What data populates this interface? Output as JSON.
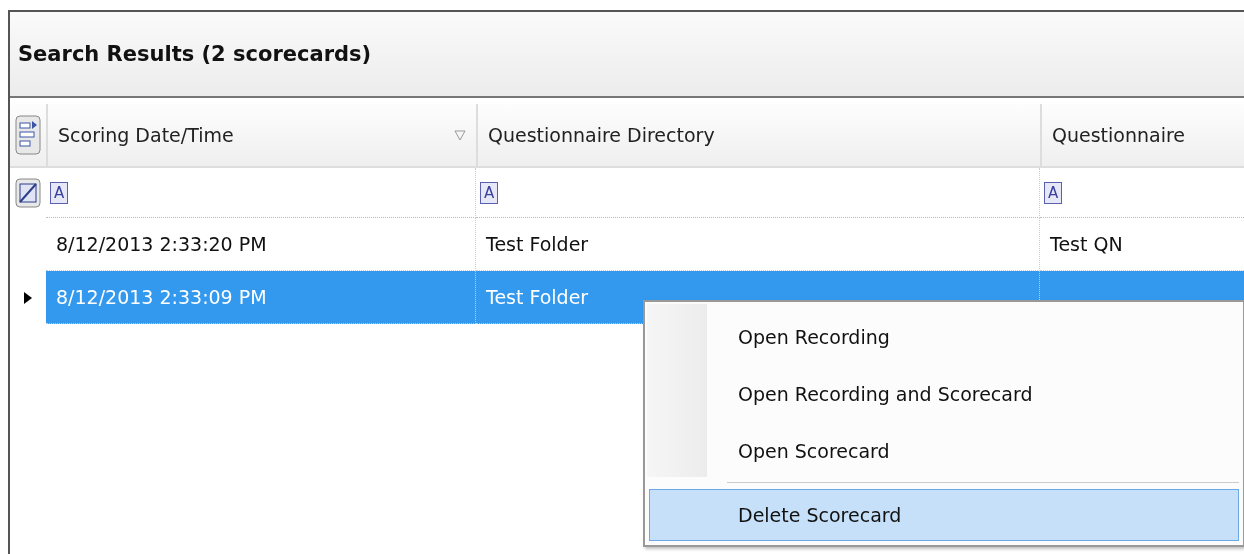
{
  "panel": {
    "title": "Search Results (2 scorecards)"
  },
  "table": {
    "columns": [
      {
        "label": "Scoring Date/Time",
        "sorted": true,
        "filter_glyph": "A"
      },
      {
        "label": "Questionnaire Directory",
        "filter_glyph": "A"
      },
      {
        "label": "Questionnaire",
        "filter_glyph": "A"
      }
    ],
    "rows": [
      {
        "selected": false,
        "cells": [
          "8/12/2013 2:33:20 PM",
          "Test Folder",
          "Test QN"
        ]
      },
      {
        "selected": true,
        "cells": [
          "8/12/2013 2:33:09 PM",
          "Test Folder"
        ]
      }
    ]
  },
  "context_menu": {
    "items": [
      {
        "kind": "item",
        "label": "Open Recording",
        "selected": false
      },
      {
        "kind": "item",
        "label": "Open Recording and Scorecard",
        "selected": false
      },
      {
        "kind": "item",
        "label": "Open Scorecard",
        "selected": false
      },
      {
        "kind": "separator"
      },
      {
        "kind": "item",
        "label": "Delete Scorecard",
        "selected": true
      }
    ]
  }
}
